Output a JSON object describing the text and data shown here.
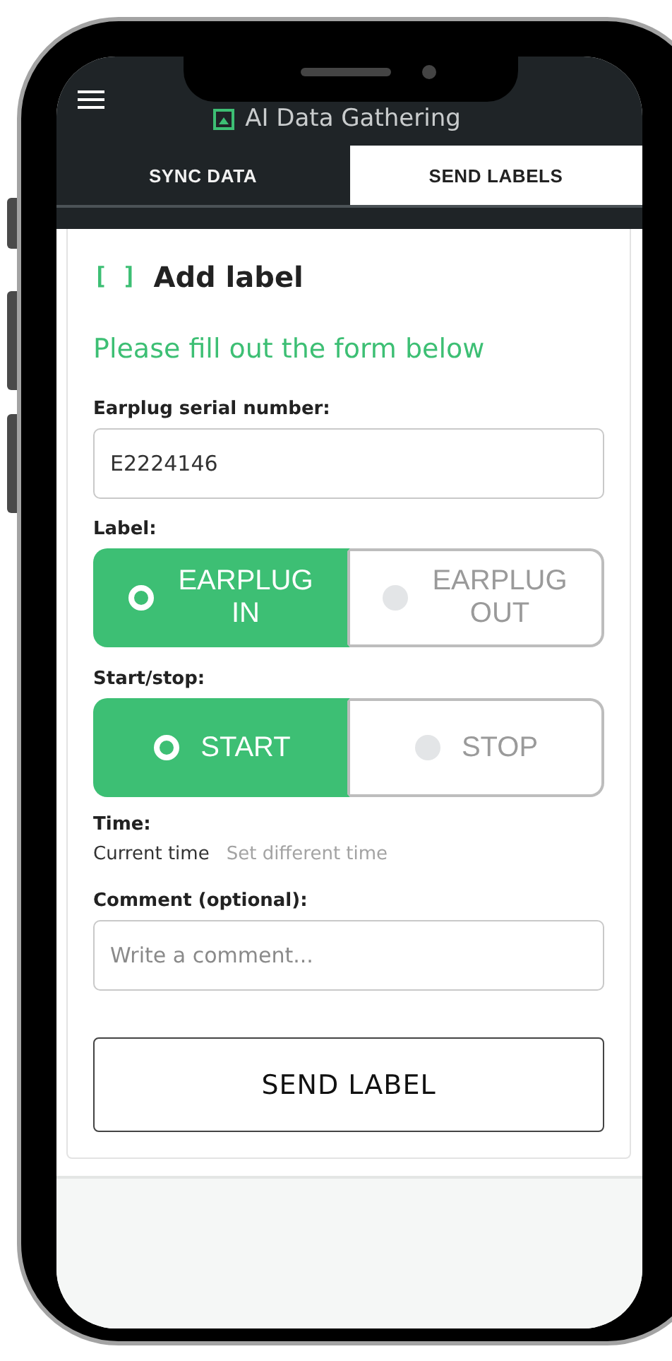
{
  "app": {
    "title": "AI Data Gathering"
  },
  "tabs": [
    {
      "label": "SYNC DATA",
      "selected": false
    },
    {
      "label": "SEND LABELS",
      "selected": true
    }
  ],
  "form": {
    "heading_mark": "[ ]",
    "heading": "Add label",
    "subtitle": "Please fill out the form below",
    "serial": {
      "label": "Earplug serial number:",
      "value": "E2224146"
    },
    "label_choice": {
      "label": "Label:",
      "options": [
        {
          "label": "EARPLUG IN",
          "selected": true
        },
        {
          "label": "EARPLUG OUT",
          "selected": false
        }
      ]
    },
    "start_stop": {
      "label": "Start/stop:",
      "options": [
        {
          "label": "START",
          "selected": true
        },
        {
          "label": "STOP",
          "selected": false
        }
      ]
    },
    "time": {
      "label": "Time:",
      "options": [
        {
          "label": "Current time",
          "selected": true
        },
        {
          "label": "Set different time",
          "selected": false
        }
      ]
    },
    "comment": {
      "label": "Comment (optional):",
      "placeholder": "Write a comment..."
    },
    "submit": "SEND LABEL"
  }
}
